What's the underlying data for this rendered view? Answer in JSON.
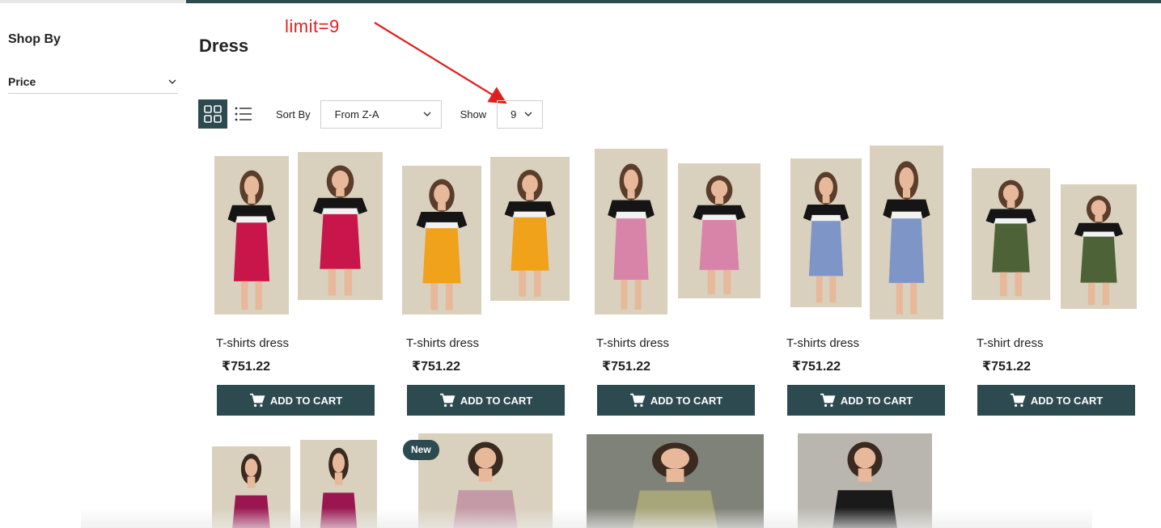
{
  "sidebar": {
    "title": "Shop By",
    "filters": [
      {
        "label": "Price"
      }
    ]
  },
  "page": {
    "title": "Dress",
    "annotation": "limit=9"
  },
  "toolbar": {
    "sort_label": "Sort By",
    "sort_value": "From Z-A",
    "show_label": "Show",
    "show_value": "9"
  },
  "products": [
    {
      "name": "T-shirts dress",
      "price": "₹751.22",
      "cart_label": "ADD TO CART",
      "color": "#c8154a"
    },
    {
      "name": "T-shirts dress",
      "price": "₹751.22",
      "cart_label": "ADD TO CART",
      "color": "#f0a21a"
    },
    {
      "name": "T-shirts dress",
      "price": "₹751.22",
      "cart_label": "ADD TO CART",
      "color": "#d884a8"
    },
    {
      "name": "T-shirts dress",
      "price": "₹751.22",
      "cart_label": "ADD TO CART",
      "color": "#7e95c8"
    },
    {
      "name": "T-shirt dress",
      "price": "₹751.22",
      "cart_label": "ADD TO CART",
      "color": "#4d6337"
    }
  ],
  "second_row": {
    "badge": "New",
    "colors": [
      "#9a1650",
      "#c49aa6",
      "#a7a57a",
      "#1a1a1a"
    ]
  },
  "colors": {
    "accent": "#2d4a50",
    "annotation": "#e02020"
  },
  "icons": [
    "chevron-down-icon",
    "grid-view-icon",
    "list-view-icon",
    "cart-icon"
  ]
}
